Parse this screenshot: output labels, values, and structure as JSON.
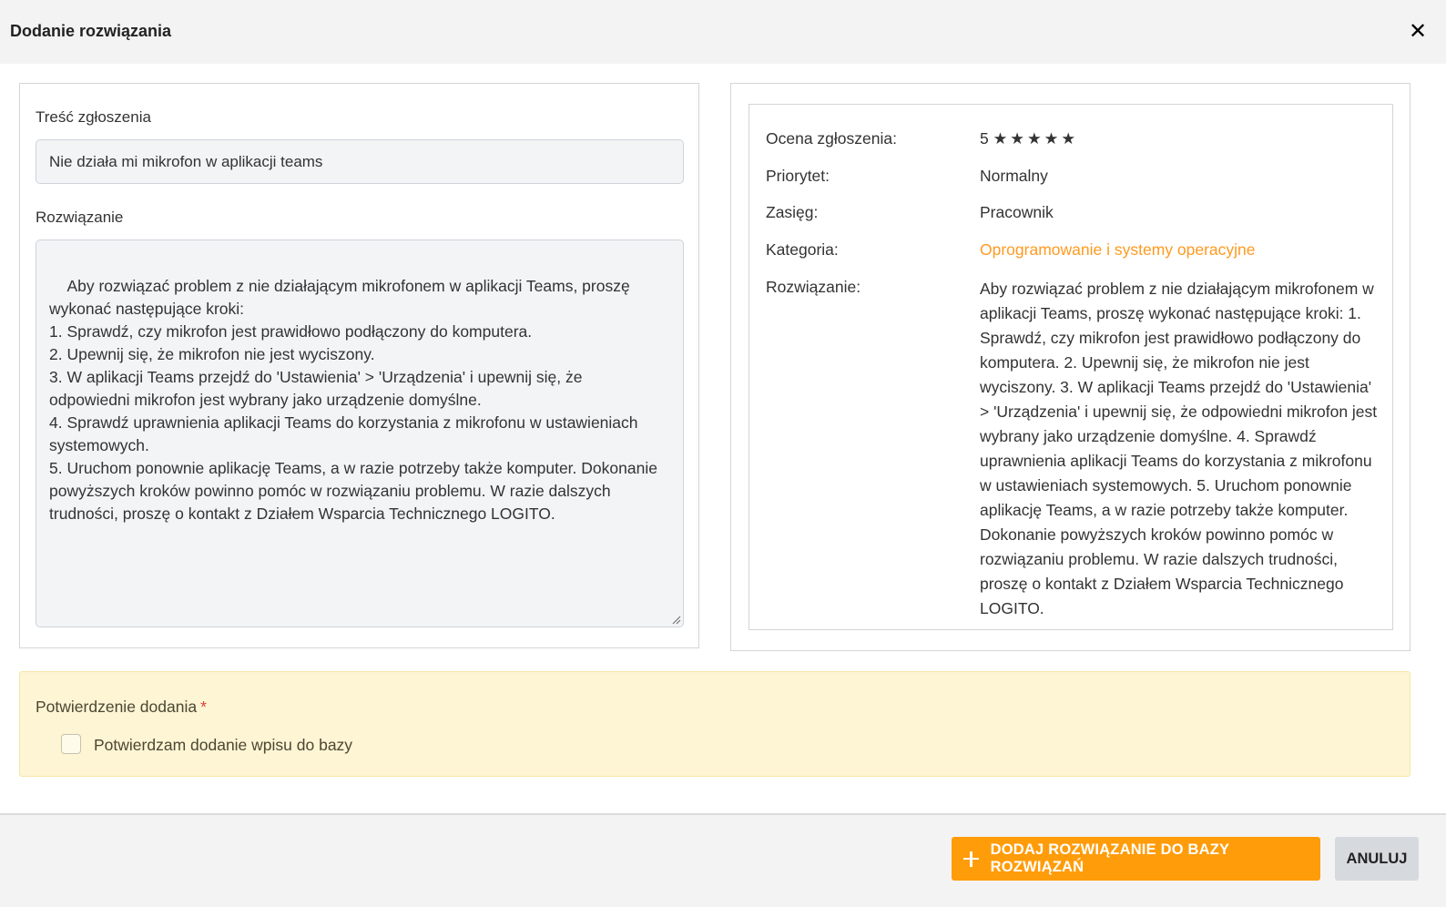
{
  "dialog": {
    "title": "Dodanie rozwiązania",
    "close_icon": "close-icon"
  },
  "left_panel": {
    "ticket_label": "Treść zgłoszenia",
    "ticket_value": "Nie działa mi mikrofon w aplikacji teams",
    "solution_label": "Rozwiązanie",
    "solution_value": "Aby rozwiązać problem z nie działającym mikrofonem w aplikacji Teams, proszę\nwykonać następujące kroki:\n1. Sprawdź, czy mikrofon jest prawidłowo podłączony do komputera.\n2. Upewnij się, że mikrofon nie jest wyciszony.\n3. W aplikacji Teams przejdź do 'Ustawienia' > 'Urządzenia' i upewnij się, że\nodpowiedni mikrofon jest wybrany jako urządzenie domyślne.\n4. Sprawdź uprawnienia aplikacji Teams do korzystania z mikrofonu w ustawieniach\nsystemowych.\n5. Uruchom ponownie aplikację Teams, a w razie potrzeby także komputer. Dokonanie\npowyższych kroków powinno pomóc w rozwiązaniu problemu. W razie dalszych\ntrudności, proszę o kontakt z Działem Wsparcia Technicznego LOGITO."
  },
  "right_panel": {
    "rating_label": "Ocena zgłoszenia:",
    "rating_value": "5",
    "rating_stars": "★★★★★",
    "rating_count": 5,
    "priority_label": "Priorytet:",
    "priority_value": "Normalny",
    "scope_label": "Zasięg:",
    "scope_value": "Pracownik",
    "category_label": "Kategoria:",
    "category_value": "Oprogramowanie i systemy operacyjne",
    "category_color": "#ff9a1f",
    "solution_label": "Rozwiązanie:",
    "solution_value": "Aby rozwiązać problem z nie działającym mikrofonem w aplikacji Teams, proszę wykonać następujące kroki: 1. Sprawdź, czy mikrofon jest prawidłowo podłączony do komputera. 2. Upewnij się, że mikrofon nie jest wyciszony. 3. W aplikacji Teams przejdź do 'Ustawienia' > 'Urządzenia' i upewnij się, że odpowiedni mikrofon jest wybrany jako urządzenie domyślne. 4. Sprawdź uprawnienia aplikacji Teams do korzystania z mikrofonu w ustawieniach systemowych. 5. Uruchom ponownie aplikację Teams, a w razie potrzeby także komputer. Dokonanie powyższych kroków powinno pomóc w rozwiązaniu problemu. W razie dalszych trudności, proszę o kontakt z Działem Wsparcia Technicznego LOGITO."
  },
  "confirmation": {
    "label": "Potwierdzenie dodania",
    "required_mark": "*",
    "checkbox_label": "Potwierdzam dodanie wpisu do bazy",
    "checked": false
  },
  "footer": {
    "add_button_label": "DODAJ ROZWIĄZANIE DO BAZY ROZWIĄZAŃ",
    "add_button_icon": "plus-icon",
    "cancel_button_label": "ANULUJ"
  },
  "colors": {
    "accent": "#ff9c0a",
    "warning_background": "#fdf5d3"
  }
}
